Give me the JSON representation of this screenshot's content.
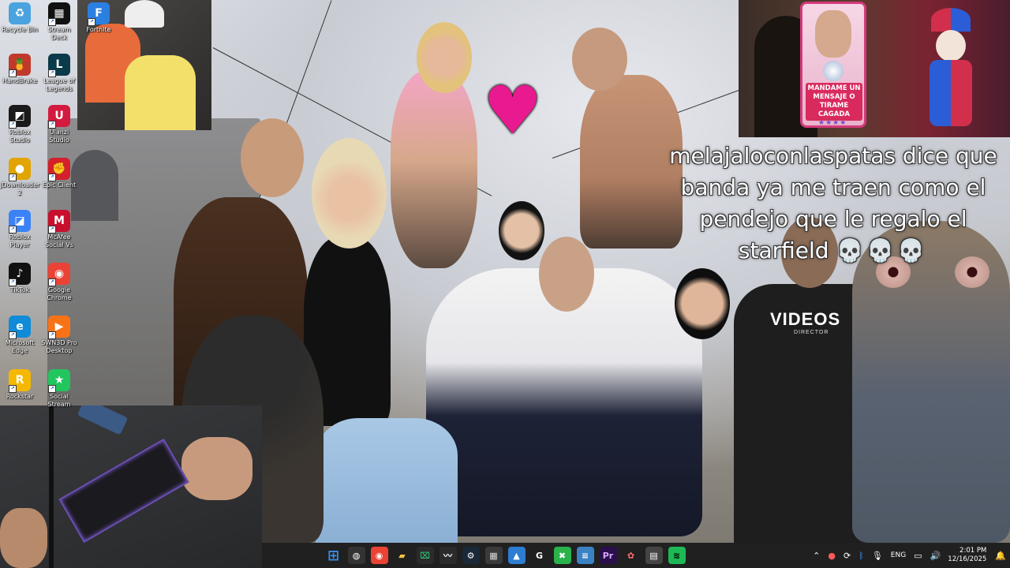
{
  "desktop": {
    "icons": [
      {
        "label": "Recycle Bin",
        "icon": "recycle-bin-icon",
        "color": "#4aa3df",
        "glyph": "♻"
      },
      {
        "label": "Stream Deck",
        "icon": "stream-deck-icon",
        "color": "#111111",
        "glyph": "▦"
      },
      {
        "label": "Fortnite",
        "icon": "fortnite-icon",
        "color": "#2a7fe0",
        "glyph": "F"
      },
      {
        "label": "HandBrake",
        "icon": "handbrake-icon",
        "color": "#c0392b",
        "glyph": "🍍"
      },
      {
        "label": "League of Legends",
        "icon": "league-of-legends-icon",
        "color": "#0b3b4a",
        "glyph": "L"
      },
      {
        "label": "Roblox Studio",
        "icon": "roblox-studio-icon",
        "color": "#1a1a1a",
        "glyph": "◩"
      },
      {
        "label": "Ulanzi Studio",
        "icon": "ulanzi-studio-icon",
        "color": "#d21b3f",
        "glyph": "U"
      },
      {
        "label": "JDownloader 2",
        "icon": "jdownloader-icon",
        "color": "#e2a400",
        "glyph": "●"
      },
      {
        "label": "Epic Client",
        "icon": "epic-client-icon",
        "color": "#d3202a",
        "glyph": "✊"
      },
      {
        "label": "Roblox Player",
        "icon": "roblox-player-icon",
        "color": "#3b82f6",
        "glyph": "◪"
      },
      {
        "label": "McAfee Social Vs",
        "icon": "mcafee-icon",
        "color": "#c8102e",
        "glyph": "M"
      },
      {
        "label": "TikTok",
        "icon": "tiktok-icon",
        "color": "#111111",
        "glyph": "♪"
      },
      {
        "label": "Google Chrome",
        "icon": "chrome-icon",
        "color": "#ea4335",
        "glyph": "◉"
      },
      {
        "label": "Microsoft Edge",
        "icon": "edge-icon",
        "color": "#0f8bd7",
        "glyph": "e"
      },
      {
        "label": "SWN3D Pro Desktop",
        "icon": "swn3d-icon",
        "color": "#f97316",
        "glyph": "▶"
      },
      {
        "label": "Rockstar",
        "icon": "rockstar-icon",
        "color": "#f5b800",
        "glyph": "R"
      },
      {
        "label": "Social Stream",
        "icon": "social-stream-icon",
        "color": "#22c55e",
        "glyph": "★"
      }
    ]
  },
  "overlay": {
    "chat_message": "melajaloconlaspatas dice que banda ya me traen como el pendejo que le regalo el starfield",
    "chat_emoji": "💀💀💀",
    "heart": "♥",
    "sticker_text": "MANDAME UN MENSAJE O TIRAME CAGADA",
    "sticker_stars": "★★★★",
    "shirt_text": "VIDEOS",
    "shirt_subtext": "DIRECTOR"
  },
  "taskbar": {
    "apps": [
      {
        "name": "start",
        "glyph": "⊞",
        "color": "#3b8eea",
        "bg": "transparent"
      },
      {
        "name": "obs",
        "glyph": "◍",
        "color": "#ffffff",
        "bg": "#333333"
      },
      {
        "name": "chrome",
        "glyph": "◉",
        "color": "#ffffff",
        "bg": "#ea4335"
      },
      {
        "name": "file-explorer",
        "glyph": "▰",
        "color": "#f5c242",
        "bg": "transparent"
      },
      {
        "name": "terminal",
        "glyph": "⌧",
        "color": "#2fbf71",
        "bg": "#2b2b2b"
      },
      {
        "name": "tiktok-live",
        "glyph": "〰",
        "color": "#ffffff",
        "bg": "#2b2b2b"
      },
      {
        "name": "steam",
        "glyph": "⚙",
        "color": "#ffffff",
        "bg": "#1b2838"
      },
      {
        "name": "calculator",
        "glyph": "▦",
        "color": "#dddddd",
        "bg": "#3a3a3a"
      },
      {
        "name": "photos",
        "glyph": "▲",
        "color": "#ffffff",
        "bg": "#2d7dd2"
      },
      {
        "name": "g-hub",
        "glyph": "G",
        "color": "#ffffff",
        "bg": "transparent"
      },
      {
        "name": "xbox",
        "glyph": "✖",
        "color": "#ffffff",
        "bg": "#2ab24b"
      },
      {
        "name": "notepad",
        "glyph": "≡",
        "color": "#ffffff",
        "bg": "#3b82c4"
      },
      {
        "name": "premiere-pro",
        "glyph": "Pr",
        "color": "#d9a7ff",
        "bg": "#2a0f4a"
      },
      {
        "name": "stream-tool",
        "glyph": "✿",
        "color": "#ff6b6b",
        "bg": "transparent"
      },
      {
        "name": "mixer",
        "glyph": "▤",
        "color": "#ffffff",
        "bg": "#444444"
      },
      {
        "name": "spotify",
        "glyph": "≋",
        "color": "#000000",
        "bg": "#1db954"
      }
    ],
    "tray": {
      "language": "ENG",
      "time": "2:01 PM",
      "date": "12/16/2025"
    }
  }
}
